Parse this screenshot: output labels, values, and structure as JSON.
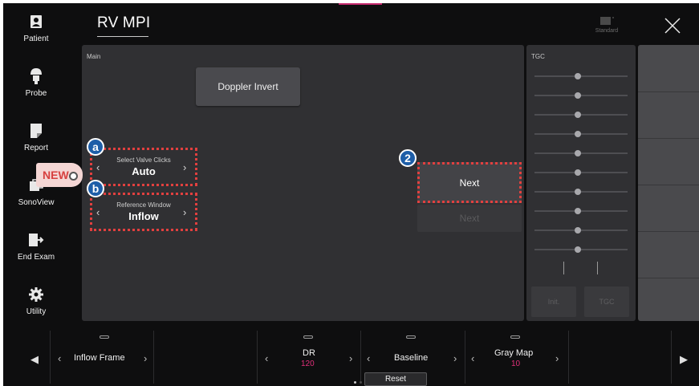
{
  "sidebar": {
    "items": [
      {
        "label": "Patient",
        "icon": "patient-icon"
      },
      {
        "label": "Probe",
        "icon": "probe-icon"
      },
      {
        "label": "Report",
        "icon": "report-icon"
      },
      {
        "label": "SonoView",
        "icon": "sonoview-icon"
      },
      {
        "label": "End Exam",
        "icon": "end-exam-icon"
      },
      {
        "label": "Utility",
        "icon": "gear-icon"
      }
    ]
  },
  "header": {
    "title": "RV MPI",
    "standard_label": "Standard",
    "accent_color": "#c4286d"
  },
  "main": {
    "panel_label": "Main",
    "doppler_invert": "Doppler Invert",
    "select_valve": {
      "caption": "Select Valve Clicks",
      "value": "Auto"
    },
    "reference_window": {
      "caption": "Reference Window",
      "value": "Inflow"
    },
    "next_label": "Next",
    "next_disabled_label": "Next",
    "annotations": {
      "badge_a": "a",
      "badge_b": "b",
      "badge_2": "2",
      "new_tag": "NEW"
    }
  },
  "tgc": {
    "panel_label": "TGC",
    "slider_count": 10,
    "init_label": "Init.",
    "tgc_label": "TGC"
  },
  "bottom": {
    "inflow_frame": "Inflow Frame",
    "dr": {
      "label": "DR",
      "value": "120"
    },
    "baseline": {
      "label": "Baseline",
      "reset": "Reset"
    },
    "gray_map": {
      "label": "Gray Map",
      "value": "10"
    }
  },
  "colors": {
    "highlight_dotted": "#e2403f",
    "badge_blue": "#1e5ea8",
    "value_pink": "#e0307a"
  }
}
